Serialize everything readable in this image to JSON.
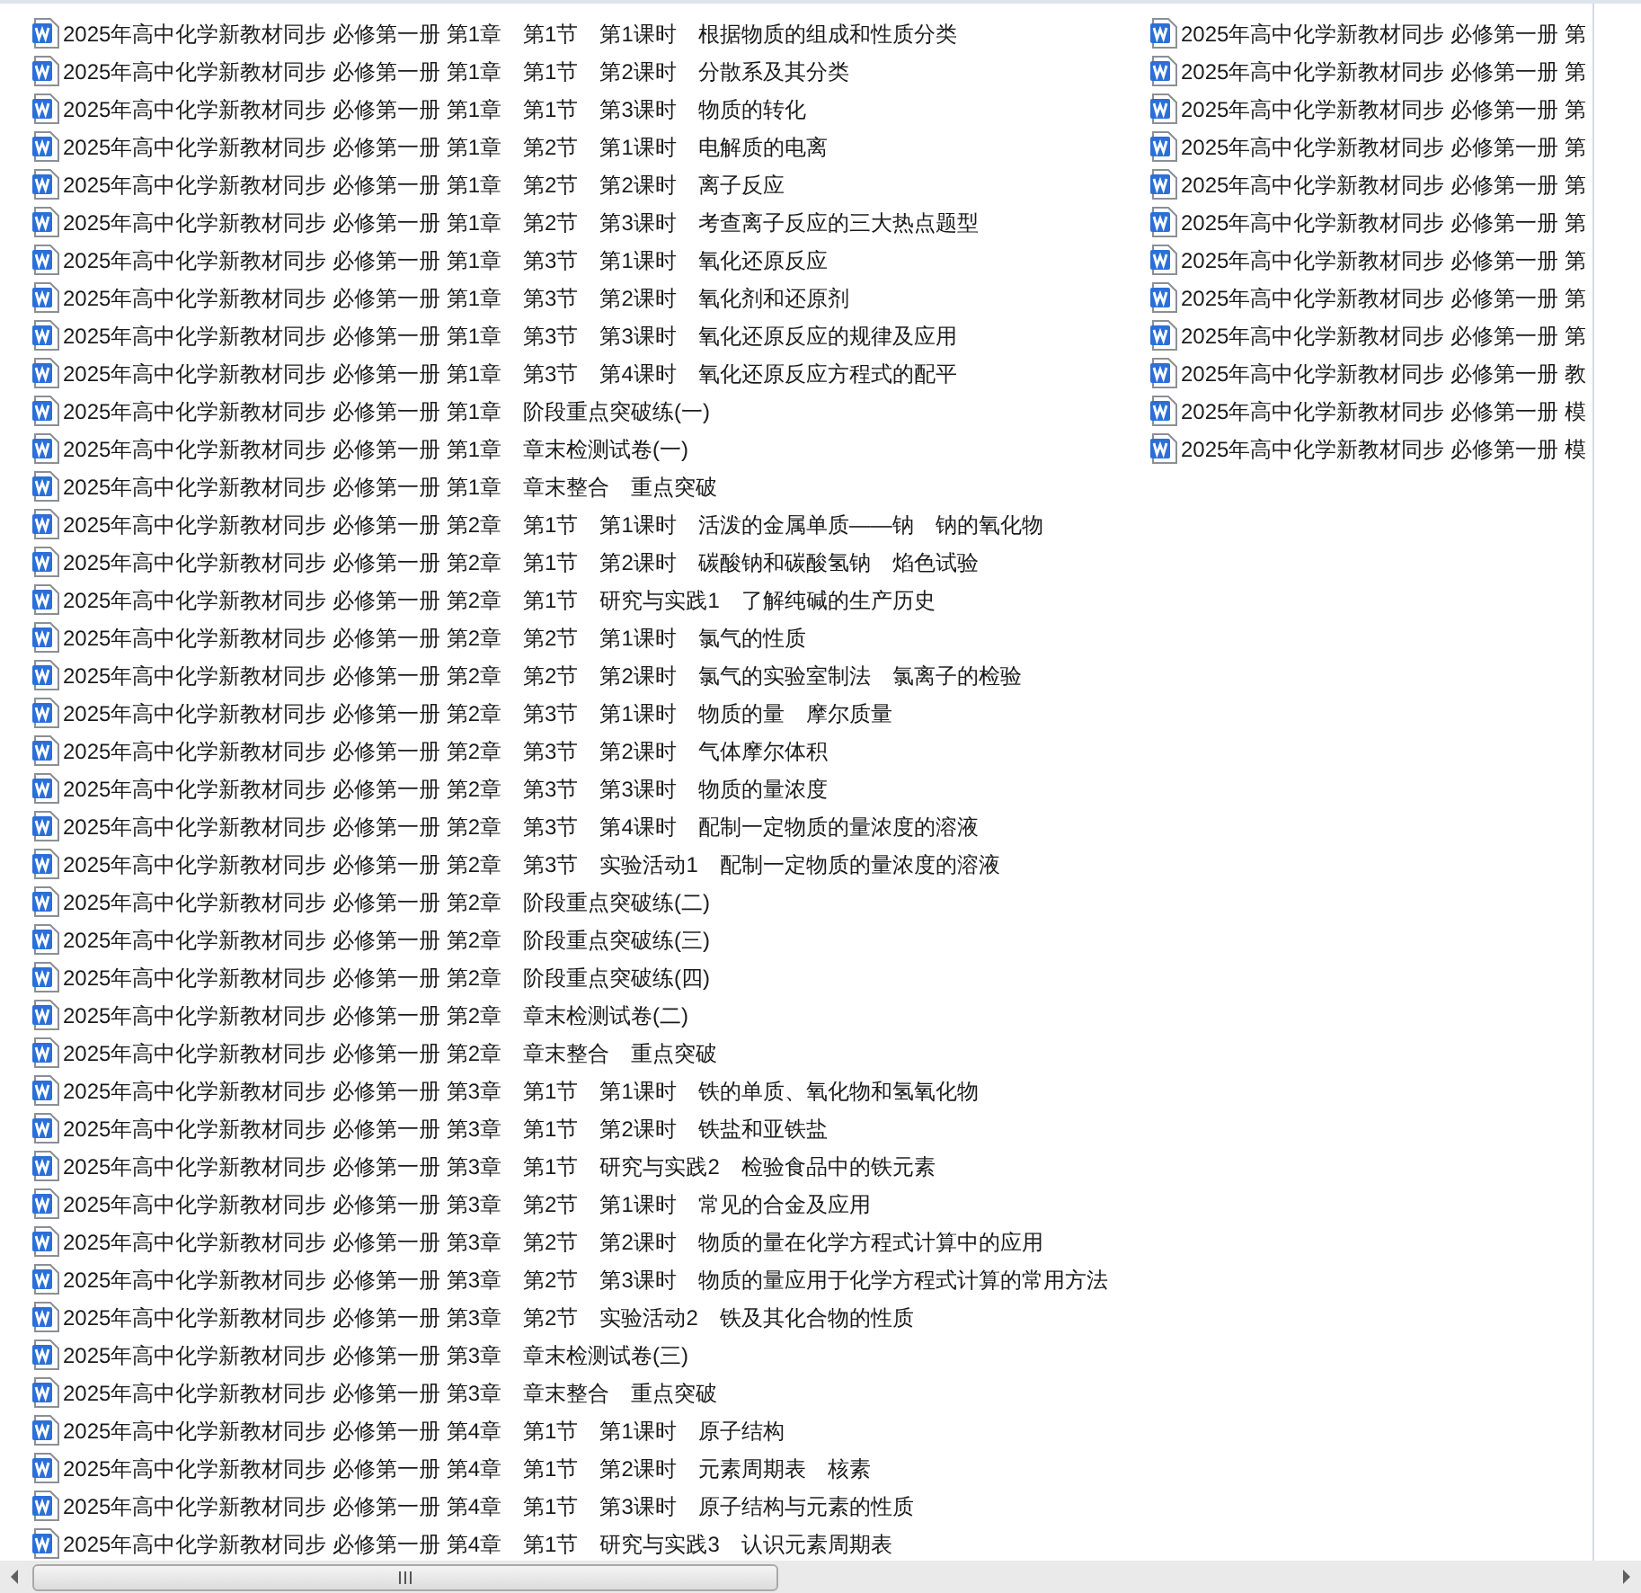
{
  "files": [
    {
      "name": "2025年高中化学新教材同步 必修第一册 第1章　第1节　第1课时　根据物质的组成和性质分类"
    },
    {
      "name": "2025年高中化学新教材同步 必修第一册 第1章　第1节　第2课时　分散系及其分类"
    },
    {
      "name": "2025年高中化学新教材同步 必修第一册 第1章　第1节　第3课时　物质的转化"
    },
    {
      "name": "2025年高中化学新教材同步 必修第一册 第1章　第2节　第1课时　电解质的电离"
    },
    {
      "name": "2025年高中化学新教材同步 必修第一册 第1章　第2节　第2课时　离子反应"
    },
    {
      "name": "2025年高中化学新教材同步 必修第一册 第1章　第2节　第3课时　考查离子反应的三大热点题型"
    },
    {
      "name": "2025年高中化学新教材同步 必修第一册 第1章　第3节　第1课时　氧化还原反应"
    },
    {
      "name": "2025年高中化学新教材同步 必修第一册 第1章　第3节　第2课时　氧化剂和还原剂"
    },
    {
      "name": "2025年高中化学新教材同步 必修第一册 第1章　第3节　第3课时　氧化还原反应的规律及应用"
    },
    {
      "name": "2025年高中化学新教材同步 必修第一册 第1章　第3节　第4课时　氧化还原反应方程式的配平"
    },
    {
      "name": "2025年高中化学新教材同步 必修第一册 第1章　阶段重点突破练(一)"
    },
    {
      "name": "2025年高中化学新教材同步 必修第一册 第1章　章末检测试卷(一)"
    },
    {
      "name": "2025年高中化学新教材同步 必修第一册 第1章　章末整合　重点突破"
    },
    {
      "name": "2025年高中化学新教材同步 必修第一册 第2章　第1节　第1课时　活泼的金属单质——钠　钠的氧化物"
    },
    {
      "name": "2025年高中化学新教材同步 必修第一册 第2章　第1节　第2课时　碳酸钠和碳酸氢钠　焰色试验"
    },
    {
      "name": "2025年高中化学新教材同步 必修第一册 第2章　第1节　研究与实践1　了解纯碱的生产历史"
    },
    {
      "name": "2025年高中化学新教材同步 必修第一册 第2章　第2节　第1课时　氯气的性质"
    },
    {
      "name": "2025年高中化学新教材同步 必修第一册 第2章　第2节　第2课时　氯气的实验室制法　氯离子的检验"
    },
    {
      "name": "2025年高中化学新教材同步 必修第一册 第2章　第3节　第1课时　物质的量　摩尔质量"
    },
    {
      "name": "2025年高中化学新教材同步 必修第一册 第2章　第3节　第2课时　气体摩尔体积"
    },
    {
      "name": "2025年高中化学新教材同步 必修第一册 第2章　第3节　第3课时　物质的量浓度"
    },
    {
      "name": "2025年高中化学新教材同步 必修第一册 第2章　第3节　第4课时　配制一定物质的量浓度的溶液"
    },
    {
      "name": "2025年高中化学新教材同步 必修第一册 第2章　第3节　实验活动1　配制一定物质的量浓度的溶液"
    },
    {
      "name": "2025年高中化学新教材同步 必修第一册 第2章　阶段重点突破练(二)"
    },
    {
      "name": "2025年高中化学新教材同步 必修第一册 第2章　阶段重点突破练(三)"
    },
    {
      "name": "2025年高中化学新教材同步 必修第一册 第2章　阶段重点突破练(四)"
    },
    {
      "name": "2025年高中化学新教材同步 必修第一册 第2章　章末检测试卷(二)"
    },
    {
      "name": "2025年高中化学新教材同步 必修第一册 第2章　章末整合　重点突破"
    },
    {
      "name": "2025年高中化学新教材同步 必修第一册 第3章　第1节　第1课时　铁的单质、氧化物和氢氧化物"
    },
    {
      "name": "2025年高中化学新教材同步 必修第一册 第3章　第1节　第2课时　铁盐和亚铁盐"
    },
    {
      "name": "2025年高中化学新教材同步 必修第一册 第3章　第1节　研究与实践2　检验食品中的铁元素"
    },
    {
      "name": "2025年高中化学新教材同步 必修第一册 第3章　第2节　第1课时　常见的合金及应用"
    },
    {
      "name": "2025年高中化学新教材同步 必修第一册 第3章　第2节　第2课时　物质的量在化学方程式计算中的应用"
    },
    {
      "name": "2025年高中化学新教材同步 必修第一册 第3章　第2节　第3课时　物质的量应用于化学方程式计算的常用方法"
    },
    {
      "name": "2025年高中化学新教材同步 必修第一册 第3章　第2节　实验活动2　铁及其化合物的性质"
    },
    {
      "name": "2025年高中化学新教材同步 必修第一册 第3章　章末检测试卷(三)"
    },
    {
      "name": "2025年高中化学新教材同步 必修第一册 第3章　章末整合　重点突破"
    },
    {
      "name": "2025年高中化学新教材同步 必修第一册 第4章　第1节　第1课时　原子结构"
    },
    {
      "name": "2025年高中化学新教材同步 必修第一册 第4章　第1节　第2课时　元素周期表　核素"
    },
    {
      "name": "2025年高中化学新教材同步 必修第一册 第4章　第1节　第3课时　原子结构与元素的性质"
    },
    {
      "name": "2025年高中化学新教材同步 必修第一册 第4章　第1节　研究与实践3　认识元素周期表"
    },
    {
      "name": "2025年高中化学新教材同步 必修第一册 第"
    },
    {
      "name": "2025年高中化学新教材同步 必修第一册 第"
    },
    {
      "name": "2025年高中化学新教材同步 必修第一册 第"
    },
    {
      "name": "2025年高中化学新教材同步 必修第一册 第"
    },
    {
      "name": "2025年高中化学新教材同步 必修第一册 第"
    },
    {
      "name": "2025年高中化学新教材同步 必修第一册 第"
    },
    {
      "name": "2025年高中化学新教材同步 必修第一册 第"
    },
    {
      "name": "2025年高中化学新教材同步 必修第一册 第"
    },
    {
      "name": "2025年高中化学新教材同步 必修第一册 第"
    },
    {
      "name": "2025年高中化学新教材同步 必修第一册 教"
    },
    {
      "name": "2025年高中化学新教材同步 必修第一册 模"
    },
    {
      "name": "2025年高中化学新教材同步 必修第一册 模"
    }
  ]
}
